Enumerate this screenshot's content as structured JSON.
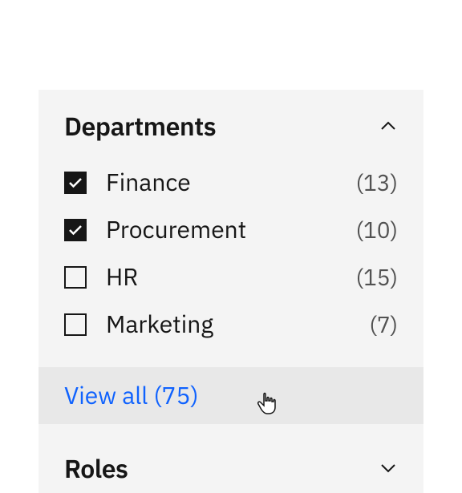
{
  "sections": [
    {
      "title": "Departments",
      "expanded": true,
      "items": [
        {
          "label": "Finance",
          "count": "(13)",
          "checked": true
        },
        {
          "label": "Procurement",
          "count": "(10)",
          "checked": true
        },
        {
          "label": "HR",
          "count": "(15)",
          "checked": false
        },
        {
          "label": "Marketing",
          "count": "(7)",
          "checked": false
        }
      ],
      "view_all": "View all (75)"
    },
    {
      "title": "Roles",
      "expanded": false
    }
  ]
}
